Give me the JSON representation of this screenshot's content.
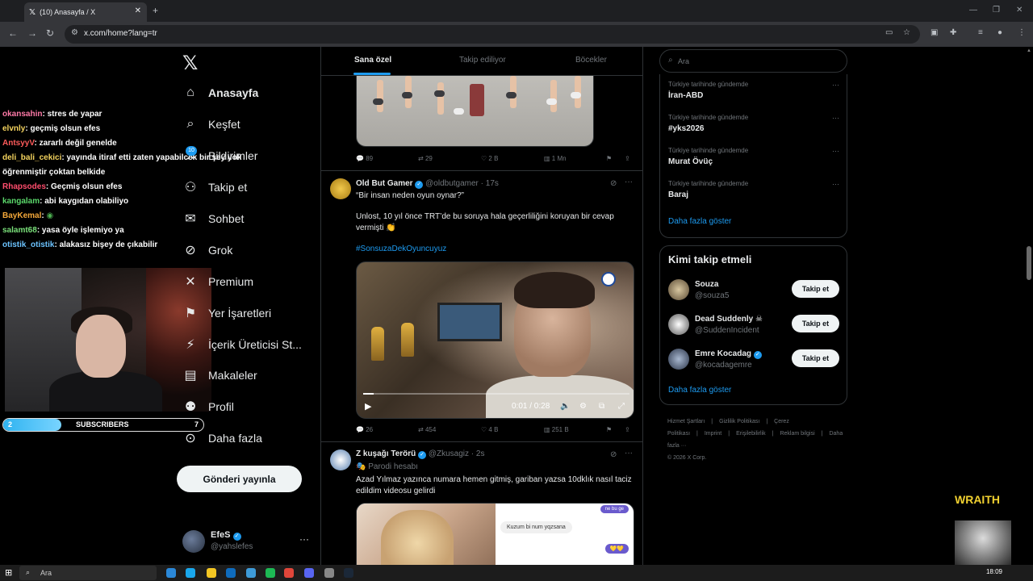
{
  "browser": {
    "tab_title": "(10) Anasayfa / X",
    "tab_close": "✕",
    "new_tab": "+",
    "url": "x.com/home?lang=tr"
  },
  "stream": {
    "chat": [
      {
        "user": "okansahin",
        "color": "#ff7aa8",
        "text": ": stres de yapar"
      },
      {
        "user": "elvnly",
        "color": "#f4d35e",
        "text": ": geçmiş olsun efes"
      },
      {
        "user": "AntsyyV",
        "color": "#ff5b5b",
        "text": ": zararlı değil genelde"
      },
      {
        "user": "deli_bali_cekici",
        "color": "#f4d35e",
        "text": ": yayında itiraf etti zaten yapabilcek bir şey yok öğrenmiştir çoktan belkide"
      },
      {
        "user": "Rhapsodes",
        "color": "#ff4d6d",
        "text": ": Geçmiş olsun efes"
      },
      {
        "user": "kangalam",
        "color": "#5bd86b",
        "text": ": abi kaygıdan olabiliyo"
      },
      {
        "user": "BayKemal",
        "color": "#f4a83a",
        "text": ": "
      },
      {
        "user": "salamt68",
        "color": "#7ae07a",
        "text": ": yasa öyle işlemiyo ya"
      },
      {
        "user": "otistik_otistik",
        "color": "#6bc3ff",
        "text": ": alakasız bişey de çıkabilir"
      }
    ],
    "subscribers": {
      "label": "SUBSCRIBERS",
      "current": "2",
      "goal": "7",
      "progress_fraction": 0.29
    }
  },
  "nav": {
    "logo": "X",
    "notification_count": "10",
    "items": [
      {
        "label": "Anasayfa",
        "icon": "home-icon",
        "glyph": "⌂"
      },
      {
        "label": "Keşfet",
        "icon": "search-icon",
        "glyph": "⌕"
      },
      {
        "label": "Bildirimler",
        "icon": "bell-icon",
        "glyph": "♫"
      },
      {
        "label": "Takip et",
        "icon": "follow-icon",
        "glyph": "⚇"
      },
      {
        "label": "Sohbet",
        "icon": "mail-icon",
        "glyph": "✉"
      },
      {
        "label": "Grok",
        "icon": "grok-icon",
        "glyph": "⊘"
      },
      {
        "label": "Premium",
        "icon": "premium-icon",
        "glyph": "✕"
      },
      {
        "label": "Yer İşaretleri",
        "icon": "bookmark-icon",
        "glyph": "⚑"
      },
      {
        "label": "İçerik Üreticisi St...",
        "icon": "creator-icon",
        "glyph": "⚡"
      },
      {
        "label": "Makaleler",
        "icon": "articles-icon",
        "glyph": "▤"
      },
      {
        "label": "Profil",
        "icon": "profile-icon",
        "glyph": "⚉"
      },
      {
        "label": "Daha fazla",
        "icon": "more-icon",
        "glyph": "⊙"
      }
    ],
    "post_button": "Gönderi yayınla",
    "account": {
      "name": "EfeS",
      "handle": "@yahslefes",
      "more": "···"
    }
  },
  "timeline": {
    "tabs": [
      "Sana özel",
      "Takip ediliyor",
      "Böcekler"
    ],
    "post0_actions": {
      "replies": "89",
      "reposts": "29",
      "likes": "2 B",
      "views": "1 Mn"
    },
    "post1": {
      "name": "Old But Gamer",
      "handle": "@oldbutgamer",
      "time": "· 17s",
      "line1": "“Bir insan neden oyun oynar?”",
      "line2": "Unlost, 10 yıl önce TRT’de bu soruya hala geçerliliğini koruyan bir cevap vermişti 👏",
      "hashtag": "#SonsuzaDekOyuncuyuz",
      "video_time": "0:01 / 0:28",
      "video_progress_fraction": 0.04,
      "actions": {
        "replies": "26",
        "reposts": "454",
        "likes": "4 B",
        "views": "251 B"
      }
    },
    "post2": {
      "name": "Z kuşağı Terörü",
      "handle": "@Zkusagiz",
      "time": "· 2s",
      "label": "Parodi hesabı",
      "text": "Azad Yılmaz yazınca numara hemen gitmiş, gariban yazsa 10dklık nasıl taciz edildim videosu gelirdi",
      "chat_text": "Kuzum bi num yqzsana",
      "chat_top": "ne bu ge"
    }
  },
  "right": {
    "search_placeholder": "Ara",
    "trends": [
      {
        "context": "Türkiye tarihinde gündemde",
        "name": "İran-ABD"
      },
      {
        "context": "Türkiye tarihinde gündemde",
        "name": "#yks2026"
      },
      {
        "context": "Türkiye tarihinde gündemde",
        "name": "Murat Övüç"
      },
      {
        "context": "Türkiye tarihinde gündemde",
        "name": "Baraj"
      }
    ],
    "show_more": "Daha fazla göster",
    "who_to_follow": {
      "title": "Kimi takip etmeli",
      "follow_label": "Takip et",
      "suggestions": [
        {
          "name": "Souza",
          "handle": "@souza5"
        },
        {
          "name": "Dead Suddenly ☠",
          "handle": "@SuddenIncident"
        },
        {
          "name": "Emre Kocadag",
          "handle": "@kocadagemre"
        }
      ],
      "show_more": "Daha fazla göster"
    },
    "footer": {
      "links": [
        "Hizmet Şartları",
        "|",
        "Gizlilik Politikası",
        "|",
        "Çerez Politikası",
        "|",
        "Imprint",
        "|",
        "Erişilebilirlik",
        "|",
        "Reklam bilgisi",
        "|",
        "Daha fazla ···"
      ],
      "copyright": "© 2026 X Corp."
    }
  },
  "overlay": {
    "wraith": "WRAITH"
  },
  "taskbar": {
    "search_placeholder": "Ara",
    "time": "18:09"
  }
}
